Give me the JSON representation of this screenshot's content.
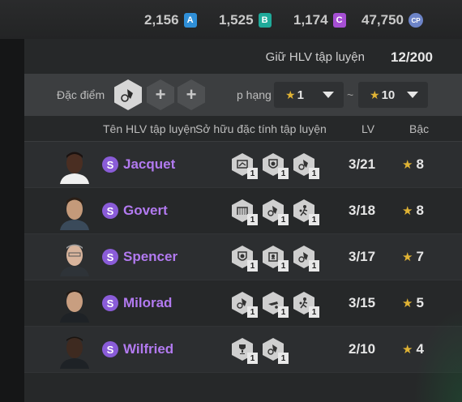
{
  "currencies": [
    {
      "value": "2,156",
      "badge": "A",
      "color": "#2f8fd8"
    },
    {
      "value": "1,525",
      "badge": "B",
      "color": "#1faa9a"
    },
    {
      "value": "1,174",
      "badge": "C",
      "color": "#a64fd4"
    },
    {
      "value": "47,750",
      "badge": "CP",
      "color": "#6d84c8"
    }
  ],
  "slots": {
    "label": "Giữ HLV tập luyện",
    "value": "12/200"
  },
  "filter": {
    "trait_label": "Đặc điểm c",
    "add_icon": "+",
    "rank_label": "p hạng",
    "rank_from": "1",
    "rank_to": "10",
    "separator": "~"
  },
  "columns": {
    "name": "Tên HLV tập luyện",
    "traits": "Sở hữu đặc tính tập luyện",
    "lv": "LV",
    "grade": "Bậc"
  },
  "coaches": [
    {
      "badge": "S",
      "name": "Jacquet",
      "traits": [
        {
          "icon": "tactics-board-icon",
          "level": "1"
        },
        {
          "icon": "shield-ball-icon",
          "level": "1"
        },
        {
          "icon": "boot-kick-icon",
          "level": "1"
        }
      ],
      "lv": "3/21",
      "grade": "8"
    },
    {
      "badge": "S",
      "name": "Govert",
      "traits": [
        {
          "icon": "goal-net-icon",
          "level": "1"
        },
        {
          "icon": "boot-kick-icon",
          "level": "1"
        },
        {
          "icon": "player-dribble-icon",
          "level": "1"
        }
      ],
      "lv": "3/18",
      "grade": "8"
    },
    {
      "badge": "S",
      "name": "Spencer",
      "traits": [
        {
          "icon": "shield-ball-icon",
          "level": "1"
        },
        {
          "icon": "goalkeeper-icon",
          "level": "1"
        },
        {
          "icon": "boot-kick-icon",
          "level": "1"
        }
      ],
      "lv": "3/17",
      "grade": "7"
    },
    {
      "badge": "S",
      "name": "Milorad",
      "traits": [
        {
          "icon": "boot-kick-icon",
          "level": "1"
        },
        {
          "icon": "sliding-tackle-icon",
          "level": "1"
        },
        {
          "icon": "player-dribble-icon",
          "level": "1"
        }
      ],
      "lv": "3/15",
      "grade": "5"
    },
    {
      "badge": "S",
      "name": "Wilfried",
      "traits": [
        {
          "icon": "trophy-icon",
          "level": "1"
        },
        {
          "icon": "boot-kick-icon",
          "level": "1"
        }
      ],
      "lv": "2/10",
      "grade": "4"
    }
  ]
}
